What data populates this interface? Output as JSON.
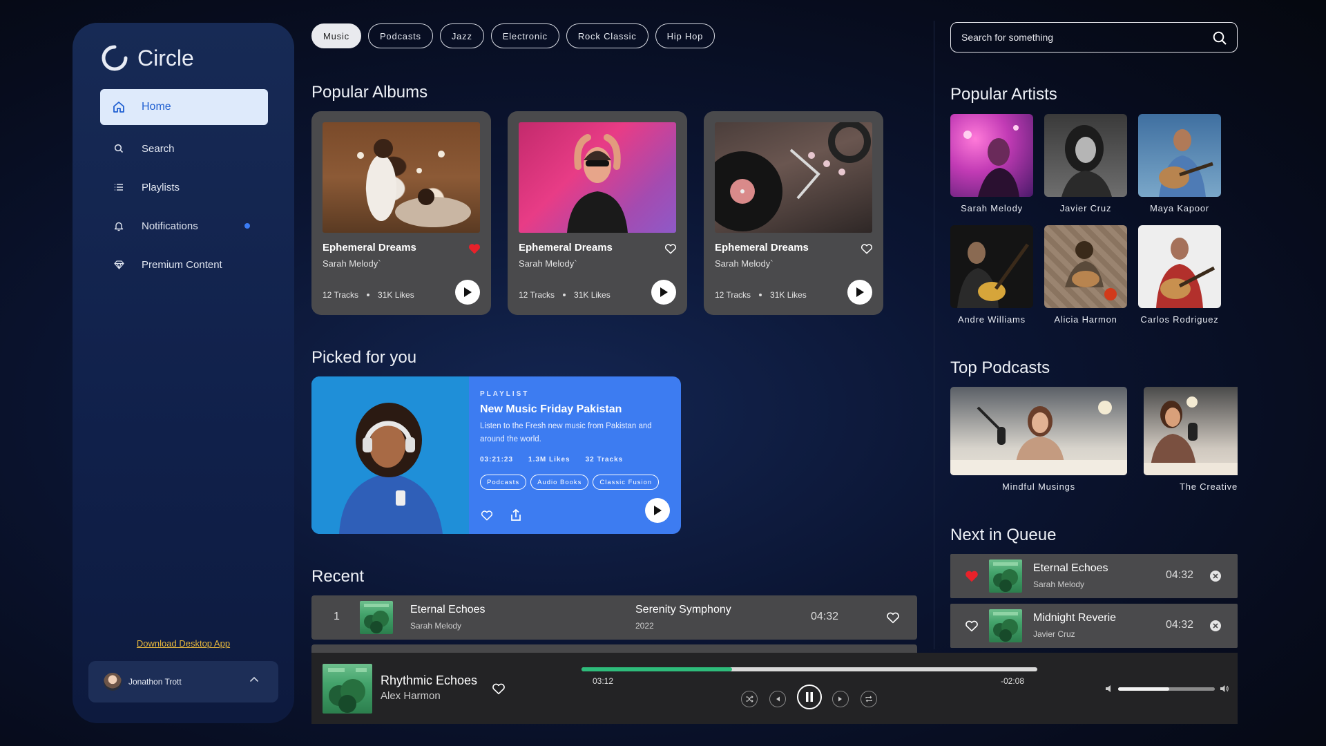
{
  "app": {
    "name": "Circle"
  },
  "sidebar": {
    "items": [
      {
        "label": "Home",
        "icon": "home-icon",
        "active": true
      },
      {
        "label": "Search",
        "icon": "search-icon"
      },
      {
        "label": "Playlists",
        "icon": "list-icon"
      },
      {
        "label": "Notifications",
        "icon": "bell-icon",
        "has_dot": true
      },
      {
        "label": "Premium Content",
        "icon": "diamond-icon"
      }
    ],
    "download_label": "Download Desktop App",
    "user": {
      "name": "Jonathon Trott"
    }
  },
  "genres": [
    {
      "label": "Music",
      "active": true
    },
    {
      "label": "Podcasts"
    },
    {
      "label": "Jazz"
    },
    {
      "label": "Electronic"
    },
    {
      "label": "Rock Classic"
    },
    {
      "label": "Hip Hop"
    }
  ],
  "popular_albums": {
    "title": "Popular Albums",
    "albums": [
      {
        "title": "Ephemeral Dreams",
        "artist": "Sarah Melody`",
        "tracks": "12 Tracks",
        "likes": "31K Likes",
        "liked": true
      },
      {
        "title": "Ephemeral Dreams",
        "artist": "Sarah Melody`",
        "tracks": "12 Tracks",
        "likes": "31K Likes",
        "liked": false
      },
      {
        "title": "Ephemeral Dreams",
        "artist": "Sarah Melody`",
        "tracks": "12 Tracks",
        "likes": "31K Likes",
        "liked": false
      }
    ]
  },
  "picked": {
    "title": "Picked for you",
    "type": "PLAYLIST",
    "name": "New Music Friday Pakistan",
    "description": "Listen to the Fresh new music from Pakistan and around the world.",
    "duration": "03:21:23",
    "likes": "1.3M Likes",
    "tracks": "32 Tracks",
    "tags": [
      "Podcasts",
      "Audio Books",
      "Classic Fusion"
    ]
  },
  "recent": {
    "title": "Recent",
    "rows": [
      {
        "num": "1",
        "title": "Eternal Echoes",
        "artist": "Sarah Melody",
        "album": "Serenity Symphony",
        "year": "2022",
        "duration": "04:32"
      }
    ]
  },
  "search": {
    "placeholder": "Search for something"
  },
  "popular_artists": {
    "title": "Popular Artists",
    "artists": [
      "Sarah Melody",
      "Javier Cruz",
      "Maya Kapoor",
      "Andre Williams",
      "Alicia Harmon",
      "Carlos Rodriguez"
    ]
  },
  "top_podcasts": {
    "title": "Top Podcasts",
    "podcasts": [
      "Mindful Musings",
      "The Creative"
    ]
  },
  "queue": {
    "title": "Next in Queue",
    "items": [
      {
        "title": "Eternal Echoes",
        "artist": "Sarah Melody",
        "duration": "04:32",
        "liked": true
      },
      {
        "title": "Midnight Reverie",
        "artist": "Javier Cruz",
        "duration": "04:32",
        "liked": false
      }
    ]
  },
  "player": {
    "title": "Rhythmic Echoes",
    "artist": "Alex Harmon",
    "elapsed": "03:12",
    "remaining": "-02:08",
    "progress_fraction": 0.33,
    "volume_fraction": 0.53
  },
  "colors": {
    "accent": "#3D7CF1",
    "progress": "#2EBC7B",
    "heart": "#E8212A",
    "link": "#E7B73C"
  }
}
